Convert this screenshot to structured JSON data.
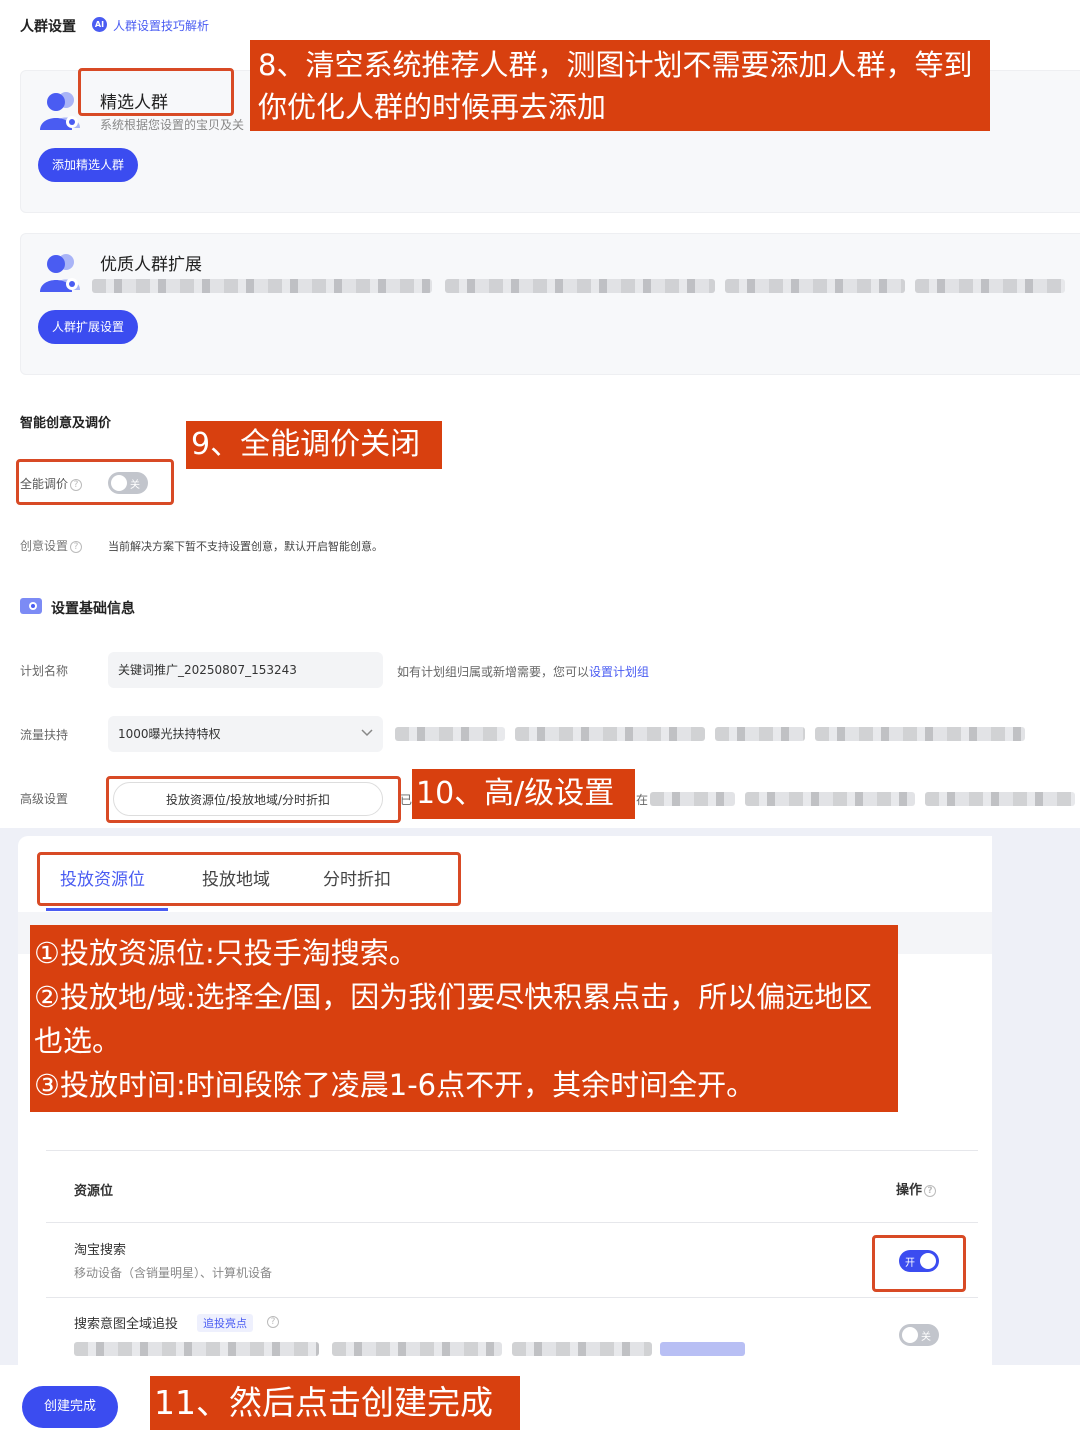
{
  "crowd": {
    "section_title": "人群设置",
    "ai_badge": "AI",
    "tips_link": "人群设置技巧解析",
    "selected_title": "精选人群",
    "selected_desc": "系统根据您设置的宝贝及关",
    "selected_button": "添加精选人群",
    "expand_title": "优质人群扩展",
    "expand_button": "人群扩展设置"
  },
  "smart": {
    "section_title": "智能创意及调价",
    "bid_label": "全能调价",
    "bid_toggle": "关",
    "creative_label": "创意设置",
    "creative_note": "当前解决方案下暂不支持设置创意，默认开启智能创意。"
  },
  "basic": {
    "section_title": "设置基础信息",
    "plan_name_label": "计划名称",
    "plan_name_value": "关键词推广_20250807_153243",
    "plan_group_hint": "如有计划组归属或新增需要，您可以",
    "plan_group_link": "设置计划组",
    "traffic_label": "流量扶持",
    "traffic_value": "1000曝光扶持特权",
    "advanced_label": "高级设置",
    "advanced_value": "投放资源位/投放地域/分时折扣",
    "advanced_trailing_a": "已",
    "advanced_trailing_b": "在"
  },
  "tabs": [
    "投放资源位",
    "投放地域",
    "分时折扣"
  ],
  "table": {
    "col_resource": "资源位",
    "col_action": "操作",
    "rows": [
      {
        "name": "淘宝搜索",
        "desc": "移动设备（含销量明星）、计算机设备",
        "toggle": "开"
      },
      {
        "name": "搜索意图全域追投",
        "tag": "追投亮点",
        "toggle": "关"
      }
    ]
  },
  "footer": {
    "create_button": "创建完成"
  },
  "annotations": {
    "a8": "8、清空系统推荐人群，测图计划不需要添加人群，等到你优化人群的时候再去添加",
    "a9": "9、全能调价关闭",
    "a10": "10、高/级设置",
    "a_steps": [
      "①投放资源位:只投手淘搜索。",
      "②投放地/域:选择全/国，因为我们要尽快积累点击，所以偏远地区也选。",
      "③投放时间:时间段除了凌晨1-6点不开，其余时间全开。"
    ],
    "a11": "11、然后点击创建完成"
  },
  "colors": {
    "accent": "#3b4cf0",
    "annotation_bg": "#d8400f",
    "annotation_border": "#d84a25"
  }
}
